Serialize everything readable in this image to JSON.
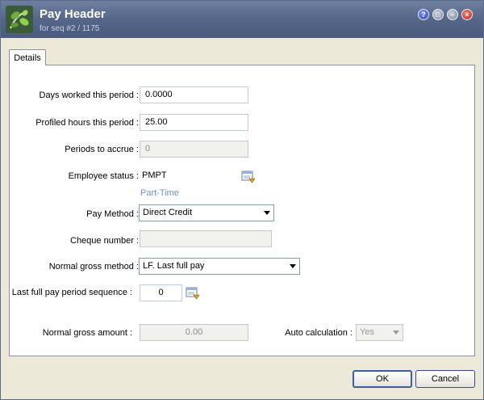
{
  "window": {
    "title": "Pay Header",
    "subtitle": "for seq #2 / 1175",
    "buttons": {
      "help": "?",
      "max": "□",
      "min": "–",
      "close": "×"
    }
  },
  "tabs": [
    {
      "label": "Details"
    }
  ],
  "form": {
    "days_worked": {
      "label": "Days worked this period :",
      "value": "0.0000"
    },
    "profiled_hours": {
      "label": "Profiled hours this period :",
      "value": "25.00"
    },
    "periods_to_accrue": {
      "label": "Periods to accrue :",
      "value": "0"
    },
    "employee_status": {
      "label": "Employee status :",
      "value": "PMPT",
      "hint": "Part-Time"
    },
    "pay_method": {
      "label": "Pay Method :",
      "value": "Direct Credit"
    },
    "cheque_number": {
      "label": "Cheque number :",
      "value": ""
    },
    "normal_gross_method": {
      "label": "Normal gross method :",
      "value": "LF. Last full pay"
    },
    "last_full_pay_seq": {
      "label": "Last full pay period sequence :",
      "value": "0"
    },
    "normal_gross_amount": {
      "label": "Normal gross amount :",
      "value": "0.00"
    },
    "auto_calculation": {
      "label": "Auto calculation :",
      "value": "Yes"
    }
  },
  "footer": {
    "ok_label": "OK",
    "cancel_label": "Cancel"
  },
  "colors": {
    "titlebar": "#55668a",
    "hint": "#6d93c9"
  }
}
